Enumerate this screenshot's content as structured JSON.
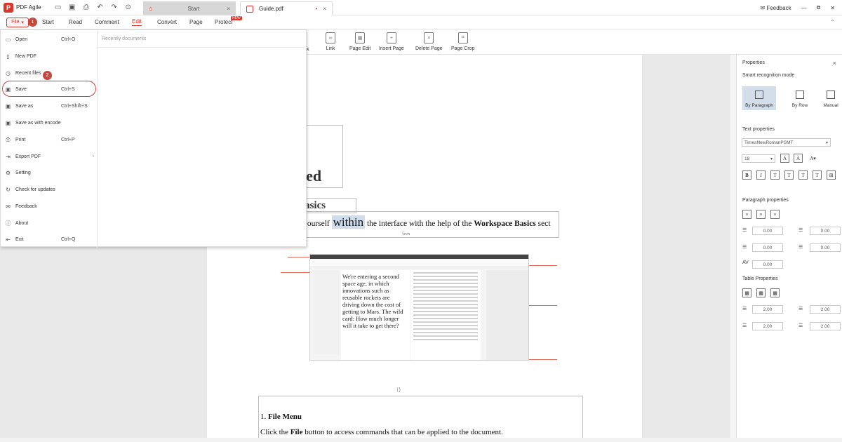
{
  "app": {
    "title": "PDF Agile",
    "logo_letter": "P"
  },
  "titlebar": {
    "tabs": [
      {
        "label": "Start"
      },
      {
        "label": "Guide.pdf",
        "modified_mark": "•"
      }
    ],
    "feedback_label": "Feedback"
  },
  "menubar": {
    "file_label": "File",
    "badges": [
      "1",
      "2"
    ],
    "items": [
      "Start",
      "Read",
      "Comment",
      "Edit",
      "Convert",
      "Page",
      "Protect"
    ],
    "new_tag": "NEW",
    "active_item": "Edit"
  },
  "toolbar": {
    "partial_label": "k",
    "tools": [
      "Link",
      "Page Edit",
      "Insert Page",
      "Delete Page",
      "Page Crop"
    ]
  },
  "file_menu": {
    "items": [
      {
        "label": "Open",
        "shortcut": "Ctrl+O",
        "icon": "folder-icon"
      },
      {
        "label": "New PDF",
        "shortcut": "",
        "icon": "new-file-icon"
      },
      {
        "label": "Recent files",
        "shortcut": "",
        "icon": "clock-icon"
      },
      {
        "label": "Save",
        "shortcut": "Ctrl+S",
        "icon": "save-icon"
      },
      {
        "label": "Save as",
        "shortcut": "Ctrl+Shift+S",
        "icon": "save-as-icon"
      },
      {
        "label": "Save as with encode",
        "shortcut": "",
        "icon": "encode-icon"
      },
      {
        "label": "Print",
        "shortcut": "Ctrl+P",
        "icon": "print-icon"
      },
      {
        "label": "Export PDF",
        "shortcut": "",
        "icon": "export-icon",
        "has_submenu": true
      },
      {
        "label": "Setting",
        "shortcut": "",
        "icon": "gear-icon"
      },
      {
        "label": "Check for updates",
        "shortcut": "",
        "icon": "refresh-icon"
      },
      {
        "label": "Feedback",
        "shortcut": "",
        "icon": "feedback-icon"
      },
      {
        "label": "About",
        "shortcut": "",
        "icon": "info-icon"
      },
      {
        "label": "Exit",
        "shortcut": "Ctrl+Q",
        "icon": "exit-icon"
      }
    ],
    "recent_title": "Recently documents"
  },
  "document": {
    "heading_fragment_1": "e",
    "heading_fragment_2": "arted",
    "section_fragment": "ce Basics",
    "intro_before": "t yourself ",
    "intro_highlight": "within",
    "intro_after": " the interface with the help of the ",
    "intro_bold": "Workspace Basics",
    "intro_end": " sect",
    "cut_text": "ion",
    "screenshot_text": "We're entering a second space age, in which innovations such as reusable rockets are driving down the cost of getting to Mars. The wild card: How much longer will it take to get there?",
    "file_menu_heading_num": "1. ",
    "file_menu_heading": "File Menu",
    "file_menu_text_before": "Click the ",
    "file_menu_text_bold": "File",
    "file_menu_text_after": " button to access commands that can be applied to the document."
  },
  "properties": {
    "title": "Properties",
    "smart_mode_label": "Smart recognition mode",
    "modes": [
      "By Paragraph",
      "By Row",
      "Manual"
    ],
    "active_mode": "By Paragraph",
    "text_properties_label": "Text properties",
    "font": "TimesNewRomanPSMT",
    "font_size": "18",
    "paragraph_properties_label": "Paragraph properties",
    "spacing_values": [
      "0.00",
      "0.00",
      "0.00",
      "0.00",
      "0.00"
    ],
    "table_properties_label": "Table Properties",
    "table_values": [
      "2.00",
      "2.00",
      "2.00",
      "2.00"
    ]
  },
  "colors": {
    "accent": "#d9362b",
    "badge": "#c8473c",
    "highlight": "#cfdcec"
  }
}
